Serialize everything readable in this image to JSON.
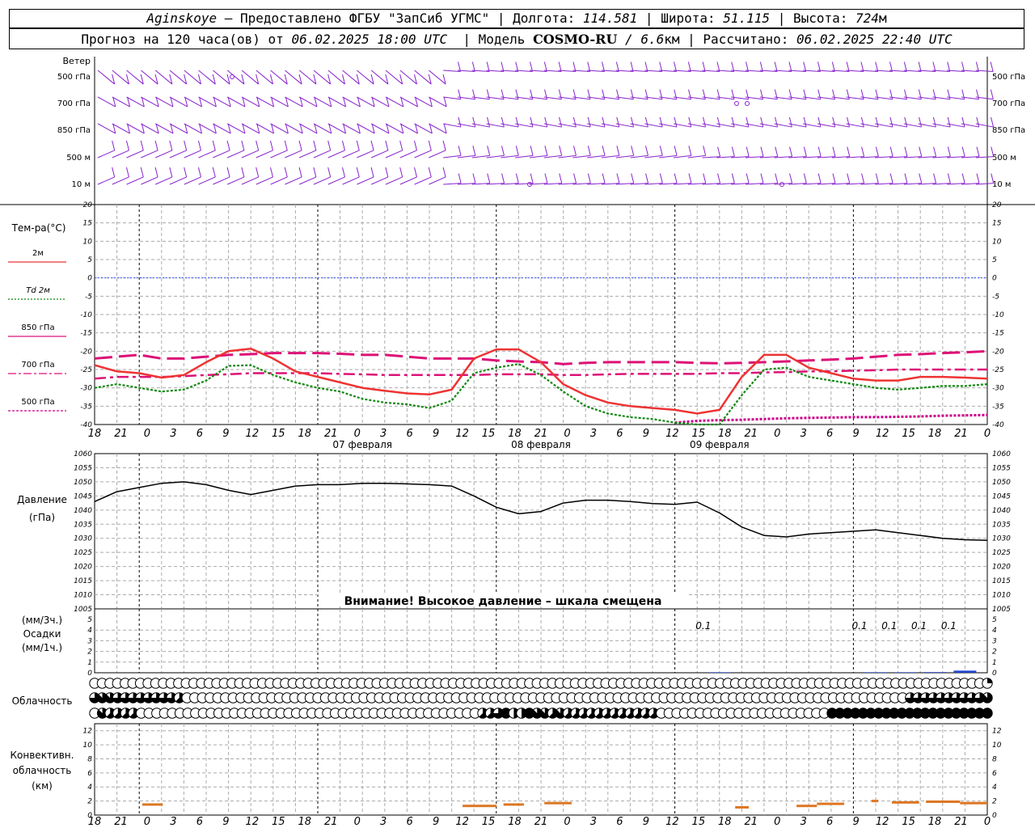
{
  "header": {
    "station": "Aginskoye",
    "provider": " – Предоставлено ФГБУ \"ЗапСиб УГМС\" | Долгота: ",
    "lon": "114.581",
    "lat_label": " | Широта: ",
    "lat": "51.115",
    "alt_label": " | Высота: ",
    "alt": "724",
    "alt_unit": "м",
    "forecast_prefix": "Прогноз на 120 часа(ов) от ",
    "forecast_from": "06.02.2025 18:00 UTC",
    "model_label": "  | Модель ",
    "model": "COSMO-RU",
    "model_res": " / 6.6",
    "model_res_unit": "км",
    "calc_label": " | Рассчитано: ",
    "calc_time": "06.02.2025 22:40 UTC"
  },
  "panels": {
    "wind": {
      "title": "Ветер",
      "levels": [
        "500 гПа",
        "700 гПа",
        "850 гПа",
        "500 м",
        "10  м"
      ]
    },
    "temp": {
      "title": "Тем-ра(°C)",
      "legend": [
        "2м",
        "Td  2м",
        "850 гПа",
        "700 гПа",
        "500 гПа"
      ]
    },
    "pressure": {
      "title": "Давление",
      "unit": "(гПа)",
      "warning": "Внимание! Высокое давление – шкала смещена"
    },
    "precip": {
      "labels": [
        "(мм/3ч.)",
        "Осадки",
        "(мм/1ч.)"
      ]
    },
    "clouds": {
      "title": "Облачность"
    },
    "convective": {
      "labels": [
        "Конвективн.",
        "облачность",
        "(км)"
      ]
    }
  },
  "time_axis": {
    "hours": [
      "18",
      "21",
      "0",
      "3",
      "6",
      "9",
      "12",
      "15",
      "18",
      "21",
      "0",
      "3",
      "6",
      "9",
      "12",
      "15",
      "18",
      "21",
      "0",
      "3",
      "6",
      "9",
      "12",
      "15",
      "18",
      "21",
      "0",
      "3",
      "6",
      "9",
      "12",
      "15",
      "18",
      "21",
      "0"
    ],
    "dates": [
      "07 февраля",
      "08 февраля",
      "09 февраля"
    ]
  },
  "colors": {
    "t2m": "#ee3333",
    "td2m": "#118811",
    "t850": "#dd1177",
    "t700": "#dd1177",
    "t500": "#cc0088",
    "zero_line": "#3355ff",
    "wind": "#8822cc",
    "pressure": "#000000",
    "precip": "#2244cc",
    "convective": "#dd7722"
  },
  "chart_data": [
    {
      "type": "line",
      "title": "Тем-ра(°C)",
      "x_hours": [
        0,
        3,
        6,
        9,
        12,
        15,
        18,
        21,
        24,
        27,
        30,
        33,
        36,
        39,
        42,
        45,
        48,
        51,
        54,
        57,
        60,
        63,
        66,
        69,
        72,
        75,
        78,
        81,
        84,
        87,
        90,
        93,
        96,
        99,
        102,
        105,
        108,
        111,
        114,
        117,
        120
      ],
      "ylim": [
        -40,
        20
      ],
      "yticks": [
        20,
        15,
        10,
        5,
        0,
        -5,
        -10,
        -15,
        -20,
        -25,
        -30,
        -35,
        -40
      ],
      "series": [
        {
          "name": "2м",
          "values": [
            -23.8,
            -25.5,
            -26,
            -27.2,
            -26.5,
            -23,
            -20,
            -19.3,
            -22,
            -25.5,
            -27,
            -28.5,
            -30,
            -30.8,
            -31.5,
            -31.8,
            -30.5,
            -22,
            -19.5,
            -19.5,
            -23,
            -29,
            -32,
            -34,
            -35,
            -35.5,
            -36,
            -37,
            -36,
            -27,
            -21,
            -21,
            -24.5,
            -26,
            -27.5,
            -28,
            -28,
            -27,
            -27,
            -27.2,
            -27.5
          ]
        },
        {
          "name": "Td  2м",
          "values": [
            -30,
            -29,
            -30,
            -31,
            -30.5,
            -28,
            -24,
            -23.8,
            -26.5,
            -28.5,
            -30,
            -31,
            -33,
            -34,
            -34.5,
            -35.5,
            -33.5,
            -26,
            -24.5,
            -23.5,
            -26.5,
            -31,
            -35,
            -37,
            -38,
            -38.5,
            -39.5,
            -41,
            -40,
            -32,
            -25,
            -24.5,
            -27,
            -28,
            -29,
            -30,
            -30.5,
            -30,
            -29.5,
            -29.5,
            -29
          ]
        },
        {
          "name": "850 гПа",
          "values": [
            -22,
            -21.5,
            -21,
            -22,
            -22,
            -21.5,
            -21,
            -20.8,
            -20.5,
            -20.5,
            -20.5,
            -20.7,
            -21,
            -21,
            -21.5,
            -22,
            -22,
            -22,
            -22.5,
            -22.8,
            -23,
            -23.5,
            -23.2,
            -23,
            -23,
            -23,
            -23,
            -23.2,
            -23.3,
            -23.2,
            -23,
            -22.8,
            -22.5,
            -22.3,
            -22,
            -21.5,
            -21,
            -20.8,
            -20.5,
            -20.3,
            -20
          ]
        },
        {
          "name": "700 гПа",
          "values": [
            -27.5,
            -27,
            -27,
            -27,
            -26.8,
            -26.5,
            -26.3,
            -26,
            -26,
            -26,
            -26,
            -26.2,
            -26.3,
            -26.5,
            -26.5,
            -26.5,
            -26.5,
            -26.5,
            -26.3,
            -26.3,
            -26.3,
            -26.5,
            -26.5,
            -26.3,
            -26.2,
            -26.2,
            -26.2,
            -26.2,
            -26,
            -26,
            -25.8,
            -25.7,
            -25.5,
            -25.5,
            -25.3,
            -25.2,
            -25,
            -25,
            -25,
            -25,
            -25
          ]
        },
        {
          "name": "500 гПа",
          "values": [
            null,
            null,
            null,
            null,
            null,
            null,
            null,
            null,
            null,
            null,
            null,
            null,
            null,
            null,
            null,
            null,
            null,
            null,
            null,
            null,
            null,
            null,
            null,
            null,
            null,
            null,
            -39.5,
            -39,
            -38.8,
            -38.7,
            -38.5,
            -38.3,
            -38.2,
            -38.1,
            -38,
            -38,
            -37.9,
            -37.8,
            -37.6,
            -37.5,
            -37.4
          ]
        }
      ]
    },
    {
      "type": "line",
      "title": "Давление",
      "ylabel": "(гПа)",
      "x_hours": [
        0,
        3,
        6,
        9,
        12,
        15,
        18,
        21,
        24,
        27,
        30,
        33,
        36,
        39,
        42,
        45,
        48,
        51,
        54,
        57,
        60,
        63,
        66,
        69,
        72,
        75,
        78,
        81,
        84,
        87,
        90,
        93,
        96,
        99,
        102,
        105,
        108,
        111,
        114,
        117,
        120
      ],
      "ylim": [
        1005,
        1060
      ],
      "yticks": [
        1060,
        1055,
        1050,
        1045,
        1040,
        1035,
        1030,
        1025,
        1020,
        1015,
        1010,
        1005
      ],
      "series": [
        {
          "name": "Давление",
          "values": [
            1043,
            1046.5,
            1048,
            1049.5,
            1050,
            1049,
            1047,
            1045.5,
            1047,
            1048.5,
            1049,
            1049,
            1049.5,
            1049.5,
            1049.3,
            1049,
            1048.5,
            1045,
            1041,
            1038.7,
            1039.5,
            1042.5,
            1043.5,
            1043.5,
            1043,
            1042.3,
            1042,
            1042.8,
            1039,
            1034,
            1031,
            1030.5,
            1031.5,
            1032,
            1032.5,
            1033,
            1032,
            1031,
            1030,
            1029.5,
            1029.3
          ]
        }
      ]
    },
    {
      "type": "bar",
      "title": "Осадки",
      "ylim": [
        0,
        5
      ],
      "yticks": [
        5,
        4,
        3,
        2,
        1,
        0
      ],
      "labels": [
        {
          "x_hour": 84,
          "text": "0.1"
        },
        {
          "x_hour": 105,
          "text": "0.1"
        },
        {
          "x_hour": 109,
          "text": "0.1"
        },
        {
          "x_hour": 113,
          "text": "0.1"
        },
        {
          "x_hour": 117,
          "text": "0.1"
        }
      ],
      "bars": [
        {
          "x_hour": 84,
          "value": 0.05
        },
        {
          "x_hour": 105,
          "value": 0.05
        },
        {
          "x_hour": 109,
          "value": 0.05
        },
        {
          "x_hour": 113,
          "value": 0.06
        },
        {
          "x_hour": 117,
          "value": 0.2
        }
      ]
    },
    {
      "type": "heatmap",
      "title": "Облачность",
      "rows": 3,
      "cells_per_row": 109,
      "cover_fraction_rows": [
        "0000000000000000000000000000000000000000000000000000000000000000000000000000000000000000000000000000000000000000000002",
        "677666666665000000000000000000000000000000000000000000000000000000000000000000000000000000000000000000000066666666667",
        "07555500000000000000000000000000000000000000000000556844877575555555555550000000000000000000000888888888888888888888"
      ]
    },
    {
      "type": "bar",
      "title": "Конвективн. облачность (км)",
      "ylim": [
        0,
        13
      ],
      "yticks": [
        12,
        10,
        8,
        6,
        4,
        2,
        0
      ],
      "segments": [
        {
          "x_from": 7,
          "x_to": 10,
          "top_km": 1.5
        },
        {
          "x_from": 54,
          "x_to": 59,
          "top_km": 1.3
        },
        {
          "x_from": 60,
          "x_to": 63,
          "top_km": 1.5
        },
        {
          "x_from": 66,
          "x_to": 70,
          "top_km": 1.7
        },
        {
          "x_from": 94,
          "x_to": 96,
          "top_km": 1.1
        },
        {
          "x_from": 103,
          "x_to": 106,
          "top_km": 1.3
        },
        {
          "x_from": 106,
          "x_to": 110,
          "top_km": 1.6
        },
        {
          "x_from": 114,
          "x_to": 115,
          "top_km": 2
        },
        {
          "x_from": 117,
          "x_to": 121,
          "top_km": 1.8
        },
        {
          "x_from": 122,
          "x_to": 127,
          "top_km": 1.9
        },
        {
          "x_from": 127,
          "x_to": 131,
          "top_km": 1.7
        }
      ]
    }
  ]
}
